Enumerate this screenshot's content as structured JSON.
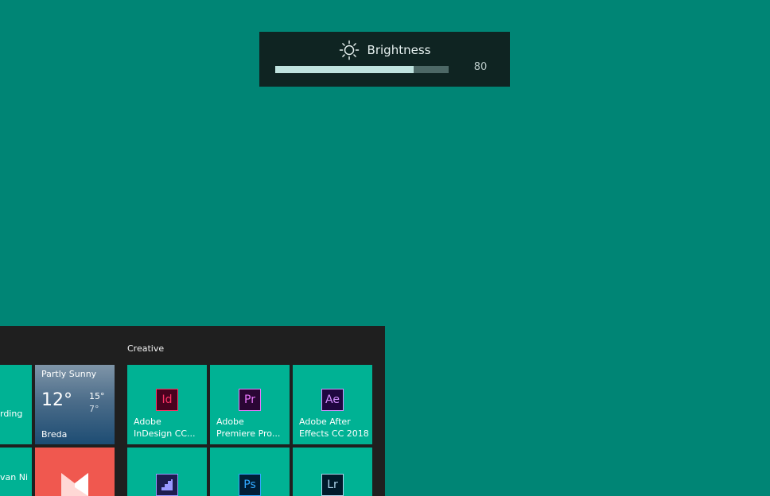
{
  "brightness": {
    "title": "Brightness",
    "value": "80",
    "level_percent": 80,
    "icon": "sun-icon"
  },
  "start_menu": {
    "group_label": "Creative",
    "partial_tiles": [
      {
        "label": "rding"
      },
      {
        "label": "van Ni"
      }
    ],
    "weather": {
      "condition": "Partly Sunny",
      "temp": "12°",
      "high": "15°",
      "low": "7°",
      "city": "Breda"
    },
    "apps": [
      {
        "abbr": "Id",
        "label": "Adobe\nInDesign CC...",
        "color": "#ff3366",
        "bg": "#49021f"
      },
      {
        "abbr": "Pr",
        "label": "Adobe\nPremiere Pro...",
        "color": "#ea77ff",
        "bg": "#2a0634"
      },
      {
        "abbr": "Ae",
        "label": "Adobe After\nEffects CC 2018",
        "color": "#d291ff",
        "bg": "#1f0740"
      },
      {
        "abbr": "",
        "label": "",
        "color": "#9999ff",
        "bg": "#1d1d4f"
      },
      {
        "abbr": "Ps",
        "label": "",
        "color": "#31a8ff",
        "bg": "#001e36"
      },
      {
        "abbr": "Lr",
        "label": "",
        "color": "#add5ec",
        "bg": "#001a2b"
      }
    ]
  },
  "colors": {
    "desktop": "#008575",
    "tile_teal": "#00b294",
    "flyout_bg": "#0f2422"
  }
}
